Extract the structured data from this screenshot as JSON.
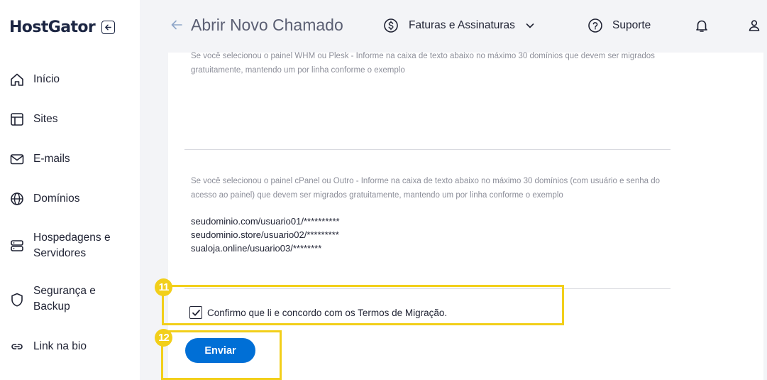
{
  "sidebar": {
    "logo": "HostGator",
    "items": [
      {
        "label": "Início",
        "icon": "home-icon"
      },
      {
        "label": "Sites",
        "icon": "layout-icon"
      },
      {
        "label": "E-mails",
        "icon": "mail-icon"
      },
      {
        "label": "Domínios",
        "icon": "globe-icon"
      },
      {
        "label": "Hospedagens e Servidores",
        "icon": "server-icon"
      },
      {
        "label": "Segurança e Backup",
        "icon": "shield-icon"
      },
      {
        "label": "Link na bio",
        "icon": "link-icon"
      }
    ]
  },
  "header": {
    "title": "Abrir Novo Chamado",
    "billing_label": "Faturas e Assinaturas",
    "support_label": "Suporte"
  },
  "form": {
    "helper_whm": "Se você selecionou o painel WHM ou Plesk - Informe na caixa de texto abaixo no máximo 30 domínios que devem ser migrados gratuitamente, mantendo um por linha conforme o exemplo",
    "helper_cpanel": "Se você selecionou o painel cPanel ou Outro - Informe na caixa de texto abaixo no máximo 30 domínios (com usuário e senha do acesso ao painel) que devem ser migrados gratuitamente, mantendo um por linha conforme o exemplo",
    "example_lines": [
      "seudominio.com/usuario01/**********",
      "seudominio.store/usuario02/*********",
      "sualoja.online/usuario03/********"
    ],
    "terms_label": "Confirmo que li e concordo com os Termos de Migração.",
    "terms_checked": true,
    "submit_label": "Enviar"
  },
  "annotations": {
    "step_terms": "11",
    "step_submit": "12"
  },
  "colors": {
    "primary": "#006fd6",
    "highlight": "#f2cf1a",
    "brand_dark": "#1b2542"
  }
}
